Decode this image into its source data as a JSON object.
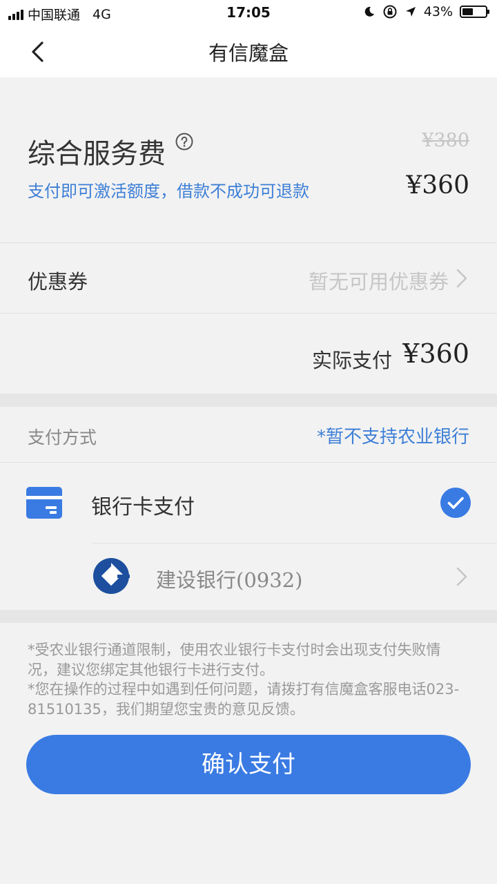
{
  "status_bar": {
    "carrier": "中国联通",
    "network": "4G",
    "time": "17:05",
    "battery_percent": "43%",
    "battery_level": 0.43,
    "icons": [
      "signal-icon",
      "moon-icon",
      "rotation-lock-icon",
      "location-arrow-icon",
      "battery-icon"
    ]
  },
  "nav": {
    "title": "有信魔盒",
    "back_icon": "chevron-left-icon"
  },
  "fee": {
    "title": "综合服务费",
    "help_icon": "question-circle-icon",
    "original_price": "¥380",
    "description": "支付即可激活额度，借款不成功可退款",
    "price": "¥360"
  },
  "coupon": {
    "label": "优惠券",
    "value": "暂无可用优惠券"
  },
  "actual": {
    "label": "实际支付",
    "price": "¥360"
  },
  "payment": {
    "header_label": "支付方式",
    "header_note": "*暂不支持农业银行",
    "method_label": "银行卡支付",
    "method_icon": "credit-card-icon",
    "selected_icon": "check-circle-icon",
    "bank_name": "建设银行",
    "bank_card_suffix": "(0932)",
    "bank_logo": "ccb-logo-icon"
  },
  "notes": {
    "line1": "*受农业银行通道限制，使用农业银行卡支付时会出现支付失败情况，建议您绑定其他银行卡进行支付。",
    "line2": "*您在操作的过程中如遇到任何问题，请拨打有信魔盒客服电话023-81510135，我们期望您宝贵的意见反馈。"
  },
  "confirm_button": "确认支付",
  "colors": {
    "accent": "#3a7be3",
    "link_blue": "#3d7fd6",
    "background": "#f2f2f2",
    "ccb_blue": "#1d4f9e"
  }
}
